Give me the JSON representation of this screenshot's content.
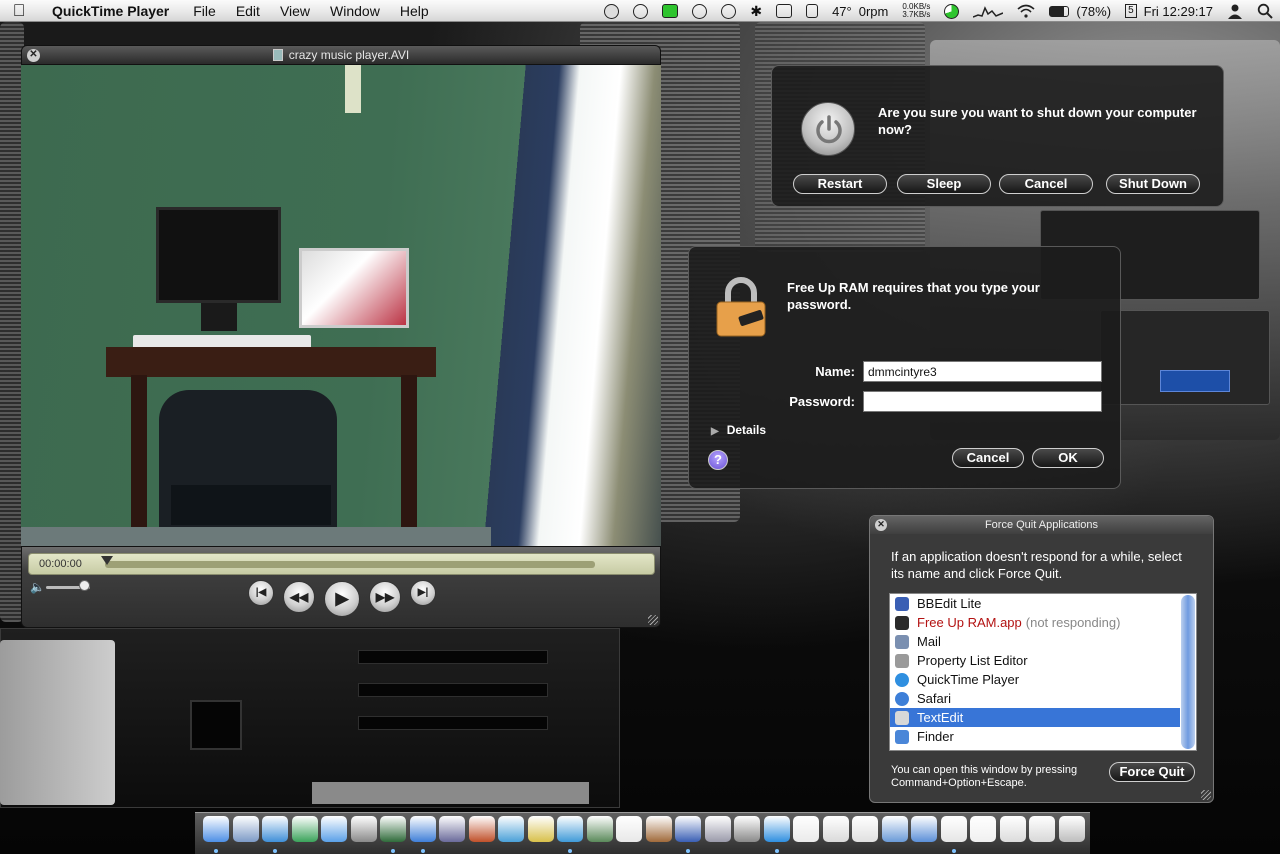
{
  "menubar": {
    "app_name": "QuickTime Player",
    "menus": [
      "File",
      "Edit",
      "View",
      "Window",
      "Help"
    ],
    "temperature": "47°",
    "fan_speed": "0rpm",
    "net_up": "0.0KB/s",
    "net_down": "3.7KB/s",
    "battery": "(78%)",
    "date_day": "5",
    "clock": "Fri 12:29:17"
  },
  "quicktime": {
    "title": "crazy music player.AVI",
    "timecode": "00:00:00"
  },
  "shutdown_dialog": {
    "message": "Are you sure you want to shut down your computer now?",
    "restart_label": "Restart",
    "sleep_label": "Sleep",
    "cancel_label": "Cancel",
    "shutdown_label": "Shut Down"
  },
  "password_dialog": {
    "message": "Free Up RAM requires that you type your password.",
    "name_label": "Name:",
    "name_value": "dmmcintyre3",
    "password_label": "Password:",
    "password_value": "",
    "details_label": "Details",
    "help_label": "?",
    "cancel_label": "Cancel",
    "ok_label": "OK"
  },
  "force_quit": {
    "title": "Force Quit Applications",
    "intro": "If an application doesn't respond for a while, select its name and click Force Quit.",
    "apps": [
      {
        "name": "BBEdit Lite",
        "status": "",
        "color": "#3a5fb4"
      },
      {
        "name": "Free Up RAM.app",
        "status": "(not responding)",
        "color": "#2a2a2a"
      },
      {
        "name": "Mail",
        "status": "",
        "color": "#7a8fb0"
      },
      {
        "name": "Property List Editor",
        "status": "",
        "color": "#9a9a9a"
      },
      {
        "name": "QuickTime Player",
        "status": "",
        "color": "#2f8fe0"
      },
      {
        "name": "Safari",
        "status": "",
        "color": "#3d7fd8"
      },
      {
        "name": "TextEdit",
        "status": "",
        "color": "#d8d8d8"
      },
      {
        "name": "Finder",
        "status": "",
        "color": "#4a86d8"
      }
    ],
    "selected_index": 6,
    "hint": "You can open this window by pressing Command+Option+Escape.",
    "button_label": "Force Quit"
  },
  "dock": {
    "icons": [
      "finder-icon",
      "preview-icon",
      "safari-icon",
      "globe-icon",
      "itunes-icon",
      "photo-icon",
      "terminal-icon",
      "quicktime-icon",
      "pen-icon",
      "presentation-icon",
      "chart-icon",
      "textedit-icon",
      "iphoto-icon",
      "image-icon",
      "usb-icon",
      "acorn-icon",
      "bbedit-icon",
      "grapher-icon",
      "system-prefs-icon",
      "quicktime-player-icon",
      "document-icon",
      "pages-icon",
      "doc-icon",
      "finder-window-icon",
      "folder-icon",
      "stack-icon",
      "note-icon",
      "docs-icon",
      "book-icon",
      "trash-icon"
    ]
  }
}
